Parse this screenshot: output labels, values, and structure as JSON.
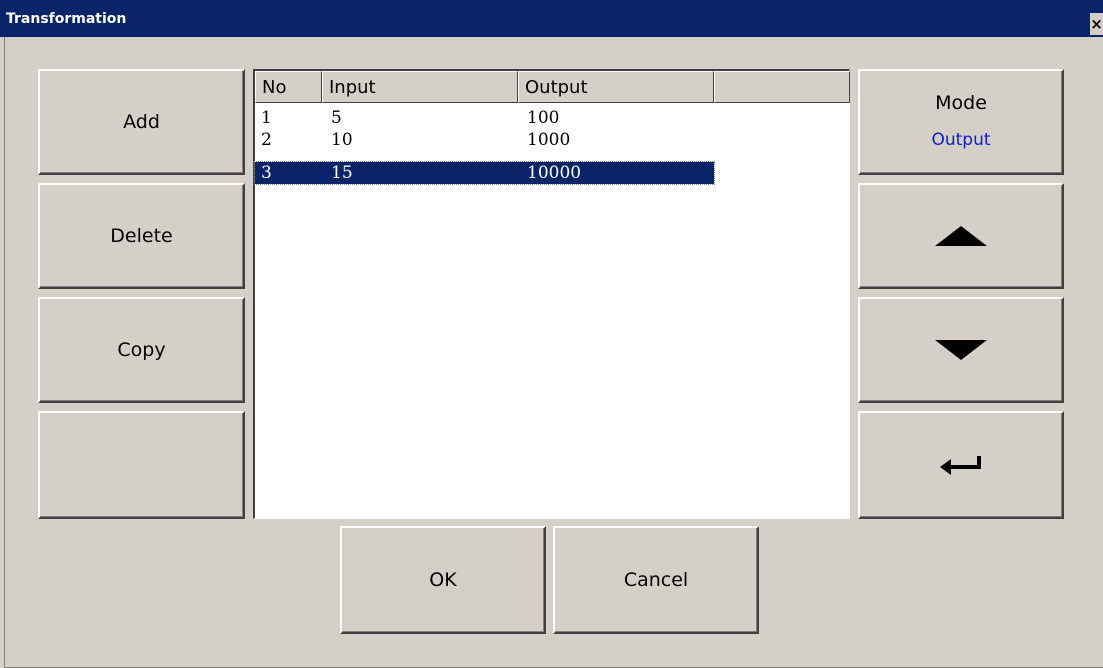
{
  "window": {
    "title": "Transformation",
    "close_glyph": "×"
  },
  "left_buttons": {
    "add": "Add",
    "delete": "Delete",
    "copy": "Copy",
    "blank": ""
  },
  "table": {
    "columns": [
      "No",
      "Input",
      "Output",
      ""
    ],
    "rows": [
      {
        "no": "1",
        "input": "5",
        "output": "100"
      },
      {
        "no": "2",
        "input": "10",
        "output": "1000"
      },
      {
        "no": "3",
        "input": "15",
        "output": "10000"
      }
    ],
    "selected_row": 3
  },
  "right_buttons": {
    "mode_label": "Mode",
    "mode_value": "Output",
    "up_icon": "triangle-up-icon",
    "down_icon": "triangle-down-icon",
    "enter_icon": "enter-icon"
  },
  "bottom_buttons": {
    "ok": "OK",
    "cancel": "Cancel"
  },
  "colors": {
    "title_bar": "#0a246a",
    "selection": "#0a246a",
    "mode_value": "#0a1ecc",
    "face": "#d4d0c8"
  }
}
